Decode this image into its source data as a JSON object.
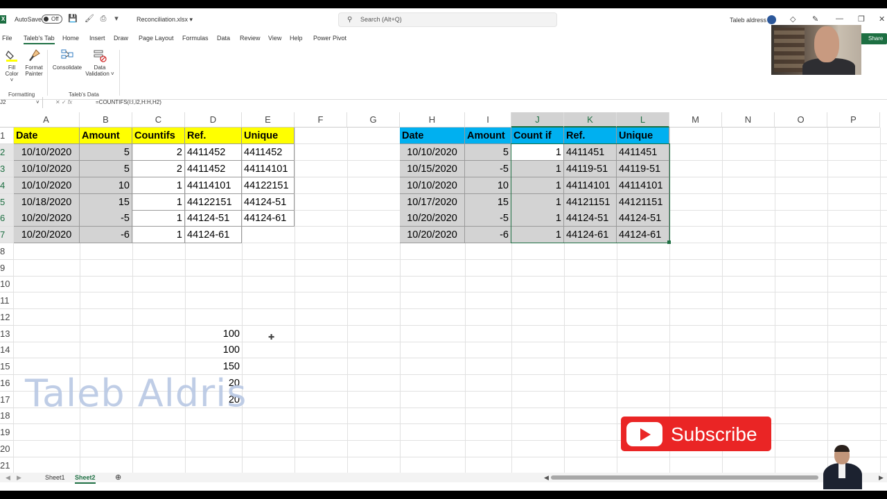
{
  "titlebar": {
    "autosave_label": "AutoSave",
    "autosave_state": "Off",
    "filename": "Reconciliation.xlsx",
    "search_placeholder": "Search (Alt+Q)",
    "user_name": "Taleb aldress"
  },
  "menu": {
    "tabs": [
      "File",
      "Taleb's Tab",
      "Home",
      "Insert",
      "Draw",
      "Page Layout",
      "Formulas",
      "Data",
      "Review",
      "View",
      "Help",
      "Power Pivot"
    ],
    "active_tab": "Taleb's Tab",
    "share_label": "Share"
  },
  "ribbon": {
    "fill_color_1": "Fill",
    "fill_color_2": "Color",
    "format_painter_1": "Format",
    "format_painter_2": "Painter",
    "consolidate": "Consolidate",
    "data_validation_1": "Data",
    "data_validation_2": "Validation",
    "group_formatting": "Formatting",
    "group_talebs_data": "Taleb's Data"
  },
  "formula_bar": {
    "name_box": "J2",
    "formula": "=COUNTIFS(I:I,I2,H:H,H2)"
  },
  "columns": [
    "A",
    "B",
    "C",
    "D",
    "E",
    "F",
    "G",
    "H",
    "I",
    "J",
    "K",
    "L",
    "M",
    "N",
    "O",
    "P"
  ],
  "rows": [
    "1",
    "2",
    "3",
    "4",
    "5",
    "6",
    "7",
    "8",
    "9",
    "10",
    "11",
    "12",
    "13",
    "14",
    "15",
    "16",
    "17",
    "18",
    "19",
    "20",
    "21"
  ],
  "table1": {
    "headers": [
      "Date",
      "Amount",
      "Countifs",
      "Ref.",
      "Unique"
    ],
    "rows": [
      [
        "10/10/2020",
        "5",
        "2",
        "4411452",
        "4411452"
      ],
      [
        "10/10/2020",
        "5",
        "2",
        "4411452",
        "44114101"
      ],
      [
        "10/10/2020",
        "10",
        "1",
        "44114101",
        "44122151"
      ],
      [
        "10/18/2020",
        "15",
        "1",
        "44122151",
        "44124-51"
      ],
      [
        "10/20/2020",
        "-5",
        "1",
        "44124-51",
        "44124-61"
      ],
      [
        "10/20/2020",
        "-6",
        "1",
        "44124-61",
        ""
      ]
    ]
  },
  "table2": {
    "headers": [
      "Date",
      "Amount",
      "Count if",
      "Ref.",
      "Unique"
    ],
    "rows": [
      [
        "10/10/2020",
        "5",
        "1",
        "4411451",
        "4411451"
      ],
      [
        "10/15/2020",
        "-5",
        "1",
        "44119-51",
        "44119-51"
      ],
      [
        "10/10/2020",
        "10",
        "1",
        "44114101",
        "44114101"
      ],
      [
        "10/17/2020",
        "15",
        "1",
        "44121151",
        "44121151"
      ],
      [
        "10/20/2020",
        "-5",
        "1",
        "44124-51",
        "44124-51"
      ],
      [
        "10/20/2020",
        "-6",
        "1",
        "44124-61",
        "44124-61"
      ]
    ]
  },
  "column_d_values": [
    "100",
    "100",
    "150",
    "20",
    "20"
  ],
  "sheets": [
    "Sheet1",
    "Sheet2"
  ],
  "active_sheet": "Sheet2",
  "watermark": "Taleb Aldris",
  "subscribe_label": "Subscribe",
  "colors": {
    "excel_green": "#1d6f42",
    "header_yellow": "#ffff00",
    "header_blue": "#00b0f0",
    "selection_grey": "#d3d3d3",
    "youtube_red": "#ea2525"
  }
}
